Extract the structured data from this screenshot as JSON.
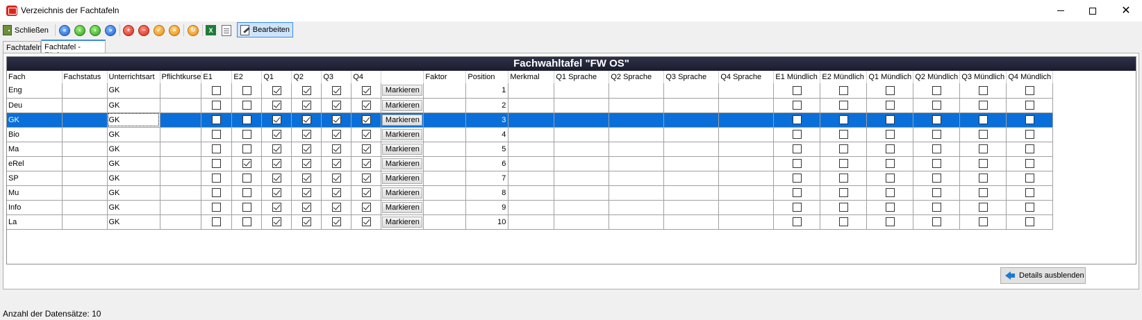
{
  "window": {
    "title": "Verzeichnis der Fachtafeln"
  },
  "toolbar": {
    "close_label": "Schließen",
    "edit_label": "Bearbeiten",
    "colors": {
      "blue": "#1d5fcc",
      "green": "#2d9b1e",
      "red": "#d22a1b",
      "orange": "#ea8b10"
    }
  },
  "tabs": [
    {
      "label": "Fachtafeln",
      "active": false
    },
    {
      "label": "Fachtafel - Fächer",
      "active": true
    }
  ],
  "grid": {
    "title": "Fachwahltafel \"FW OS\"",
    "columns": [
      "Fach",
      "Fachstatus",
      "Unterrichtsart",
      "Pflichtkurse",
      "E1",
      "E2",
      "Q1",
      "Q2",
      "Q3",
      "Q4",
      "",
      "Faktor",
      "Position",
      "Merkmal",
      "Q1 Sprache",
      "Q2 Sprache",
      "Q3 Sprache",
      "Q4 Sprache",
      "E1 Mündlich",
      "E2 Mündlich",
      "Q1 Mündlich",
      "Q2 Mündlich",
      "Q3 Mündlich",
      "Q4 Mündlich"
    ],
    "button_label": "Markieren",
    "selected_index": 2,
    "rows": [
      {
        "fach": "Eng",
        "status": "",
        "art": "GK",
        "pflicht": "",
        "e1": false,
        "e2": false,
        "q1": true,
        "q2": true,
        "q3": true,
        "q4": true,
        "faktor": "",
        "position": "1",
        "merkmal": ""
      },
      {
        "fach": "Deu",
        "status": "",
        "art": "GK",
        "pflicht": "",
        "e1": false,
        "e2": false,
        "q1": true,
        "q2": true,
        "q3": true,
        "q4": true,
        "faktor": "",
        "position": "2",
        "merkmal": ""
      },
      {
        "fach": "GK",
        "status": "",
        "art": "GK",
        "pflicht": "",
        "e1": false,
        "e2": false,
        "q1": true,
        "q2": true,
        "q3": true,
        "q4": true,
        "faktor": "",
        "position": "3",
        "merkmal": ""
      },
      {
        "fach": "Bio",
        "status": "",
        "art": "GK",
        "pflicht": "",
        "e1": false,
        "e2": false,
        "q1": true,
        "q2": true,
        "q3": true,
        "q4": true,
        "faktor": "",
        "position": "4",
        "merkmal": ""
      },
      {
        "fach": "Ma",
        "status": "",
        "art": "GK",
        "pflicht": "",
        "e1": false,
        "e2": false,
        "q1": true,
        "q2": true,
        "q3": true,
        "q4": true,
        "faktor": "",
        "position": "5",
        "merkmal": ""
      },
      {
        "fach": "eRel",
        "status": "",
        "art": "GK",
        "pflicht": "",
        "e1": false,
        "e2": true,
        "q1": true,
        "q2": true,
        "q3": true,
        "q4": true,
        "faktor": "",
        "position": "6",
        "merkmal": ""
      },
      {
        "fach": "SP",
        "status": "",
        "art": "GK",
        "pflicht": "",
        "e1": false,
        "e2": false,
        "q1": true,
        "q2": true,
        "q3": true,
        "q4": true,
        "faktor": "",
        "position": "7",
        "merkmal": ""
      },
      {
        "fach": "Mu",
        "status": "",
        "art": "GK",
        "pflicht": "",
        "e1": false,
        "e2": false,
        "q1": true,
        "q2": true,
        "q3": true,
        "q4": true,
        "faktor": "",
        "position": "8",
        "merkmal": ""
      },
      {
        "fach": "Info",
        "status": "",
        "art": "GK",
        "pflicht": "",
        "e1": false,
        "e2": false,
        "q1": true,
        "q2": true,
        "q3": true,
        "q4": true,
        "faktor": "",
        "position": "9",
        "merkmal": ""
      },
      {
        "fach": "La",
        "status": "",
        "art": "GK",
        "pflicht": "",
        "e1": false,
        "e2": false,
        "q1": true,
        "q2": true,
        "q3": true,
        "q4": true,
        "faktor": "",
        "position": "10",
        "merkmal": ""
      }
    ]
  },
  "details_button": {
    "label": "Details ausblenden"
  },
  "status": {
    "text": "Anzahl der Datensätze: 10"
  }
}
